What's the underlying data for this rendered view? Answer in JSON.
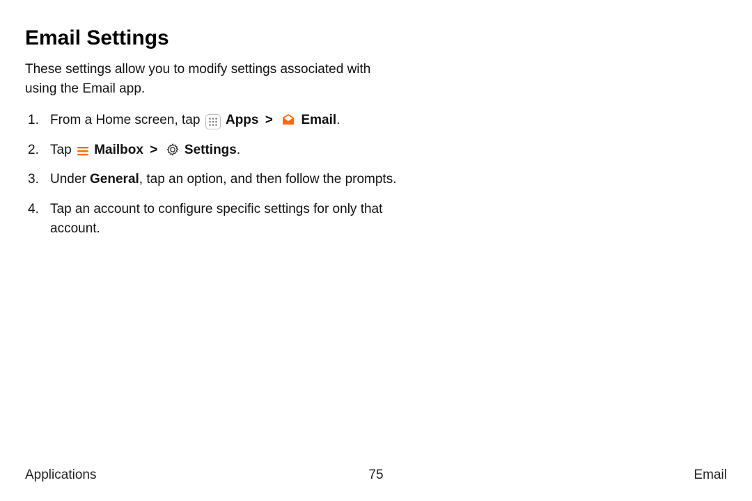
{
  "title": "Email Settings",
  "intro": "These settings allow you to modify settings associated with using the Email app.",
  "steps": {
    "s1": {
      "pre": "From a Home screen, tap ",
      "apps": "Apps",
      "sep": ">",
      "email": "Email",
      "period": "."
    },
    "s2": {
      "pre": "Tap ",
      "mailbox": "Mailbox",
      "sep": ">",
      "settings": "Settings",
      "period": "."
    },
    "s3": {
      "pre": "Under ",
      "general": "General",
      "post": ", tap an option, and then follow the prompts."
    },
    "s4": "Tap an account to configure specific settings for only that account."
  },
  "footer": {
    "left": "Applications",
    "center": "75",
    "right": "Email"
  }
}
